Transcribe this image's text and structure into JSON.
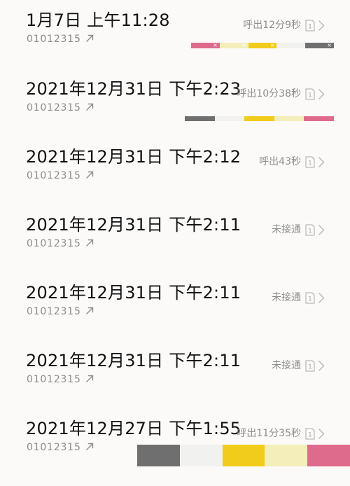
{
  "calls": [
    {
      "time": "1月7日 上午11:28",
      "number": "01012315",
      "status": "呼出12分9秒"
    },
    {
      "time": "2021年12月31日 下午2:23",
      "number": "01012315",
      "status": "呼出10分38秒"
    },
    {
      "time": "2021年12月31日 下午2:12",
      "number": "01012315",
      "status": "呼出43秒"
    },
    {
      "time": "2021年12月31日 下午2:11",
      "number": "01012315",
      "status": "未接通"
    },
    {
      "time": "2021年12月31日 下午2:11",
      "number": "01012315",
      "status": "未接通"
    },
    {
      "time": "2021年12月31日 下午2:11",
      "number": "01012315",
      "status": "未接通"
    },
    {
      "time": "2021年12月27日 下午1:55",
      "number": "01012315",
      "status": "呼出11分35秒"
    }
  ],
  "sim_label": "1",
  "swatch_close_glyph": "×",
  "icons": {
    "call_direction": "outgoing-arrow-icon",
    "sim": "sim-card-icon",
    "detail": "chevron-right-icon"
  },
  "colors": {
    "background": "#fbfaf8",
    "primary_text": "#111111",
    "secondary_text": "#8b8b8b",
    "palette": [
      "#de6a8c",
      "#f4eeba",
      "#f2cc1b",
      "#f1f1ef",
      "#6f6f6f"
    ]
  }
}
